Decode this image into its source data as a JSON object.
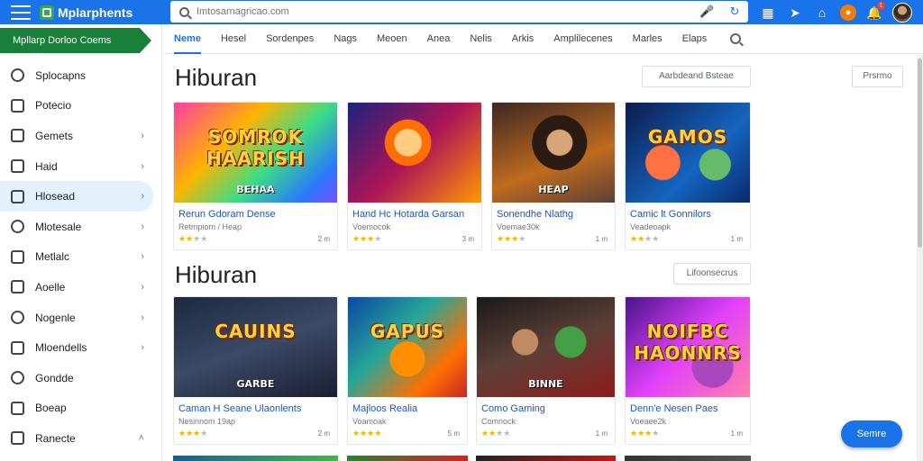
{
  "topbar": {
    "brand": "Mplarphents",
    "search_placeholder": "Imtosarnagricao.com",
    "icons": [
      "menu-icon",
      "search-icon",
      "mic-icon",
      "refresh-icon",
      "apps-icon",
      "send-icon",
      "home-icon",
      "account-icon",
      "notifications-icon"
    ],
    "notification_count": "1"
  },
  "sidebar": {
    "banner": "Mpllarp Dorloo Coems",
    "items": [
      {
        "label": "Splocapns",
        "icon": "gamepad-icon",
        "chevron": false
      },
      {
        "label": "Potecio",
        "icon": "shop-icon",
        "chevron": false
      },
      {
        "label": "Gemets",
        "icon": "calendar-icon",
        "chevron": true
      },
      {
        "label": "Haid",
        "icon": "chart-icon",
        "chevron": true
      },
      {
        "label": "Hlosead",
        "icon": "image-icon",
        "chevron": true,
        "active": true
      },
      {
        "label": "Mlotesale",
        "icon": "controller-icon",
        "chevron": true
      },
      {
        "label": "Metlalc",
        "icon": "list-icon",
        "chevron": true
      },
      {
        "label": "Aoelle",
        "icon": "pen-icon",
        "chevron": true
      },
      {
        "label": "Nogenle",
        "icon": "globe-icon",
        "chevron": true
      },
      {
        "label": "Mloendells",
        "icon": "wrench-icon",
        "chevron": true
      },
      {
        "label": "Gondde",
        "icon": "circle-icon",
        "chevron": false
      },
      {
        "label": "Boeap",
        "icon": "photo-icon",
        "chevron": false
      },
      {
        "label": "Ranecte",
        "icon": "menu-list-icon",
        "chevron": true,
        "chevron_up": true
      }
    ]
  },
  "tabs": {
    "items": [
      "Neme",
      "Hesel",
      "Sordenpes",
      "Nags",
      "Meoen",
      "Anea",
      "Nelis",
      "Arkis",
      "Amplilecenes",
      "Marles",
      "Elaps"
    ],
    "active_index": 0
  },
  "sections": [
    {
      "title": "Hiburan",
      "button": "Aarbdeand Bsteae",
      "cards": [
        {
          "title": "Rerun Gdoram Dense",
          "sub": "Retmpiom / Heap",
          "rating": 2,
          "size": "2 m"
        },
        {
          "title": "Hand Hc Hotarda Garsan",
          "sub": "Voemocok",
          "rating": 3,
          "size": "3 m"
        },
        {
          "title": "Sonendhe Nlathg",
          "sub": "Voemae30k",
          "rating": 3,
          "size": "1 m"
        },
        {
          "title": "Camic lt Gonnilors",
          "sub": "Veadeoapk",
          "rating": 2,
          "size": "1 m"
        }
      ]
    },
    {
      "title": "Hiburan",
      "button": "Lifoonsecrus",
      "cards": [
        {
          "title": "Caman H Seane Ulaonlents",
          "sub": "Nesinnom 19ap",
          "rating": 3,
          "size": "2 m"
        },
        {
          "title": "Majloos Realia",
          "sub": "Voamoak",
          "rating": 4,
          "size": "5 m"
        },
        {
          "title": "Como Gaming",
          "sub": "Comnock",
          "rating": 2,
          "size": "1 m"
        },
        {
          "title": "Denn'e Nesen Paes",
          "sub": "Voeaee2k",
          "rating": 3,
          "size": "1 m"
        }
      ]
    }
  ],
  "header_button": "Prsrmo",
  "thumbnails": [
    {
      "text": "SOMROK HAARISH",
      "subtext": "BEHAA"
    },
    {
      "text": "",
      "subtext": ""
    },
    {
      "text": "",
      "subtext": "HEAP"
    },
    {
      "text": "GAMOS",
      "subtext": ""
    },
    {
      "text": "CAUINS",
      "subtext": "GARBE"
    },
    {
      "text": "GAPUS",
      "subtext": ""
    },
    {
      "text": "",
      "subtext": "BINNE"
    },
    {
      "text": "NOIFBC HAONNRS",
      "subtext": ""
    }
  ],
  "fab": "Semre",
  "colors": {
    "primary": "#1a73e8",
    "brand_green": "#188038",
    "star": "#f4b400",
    "link": "#1a56c8"
  }
}
